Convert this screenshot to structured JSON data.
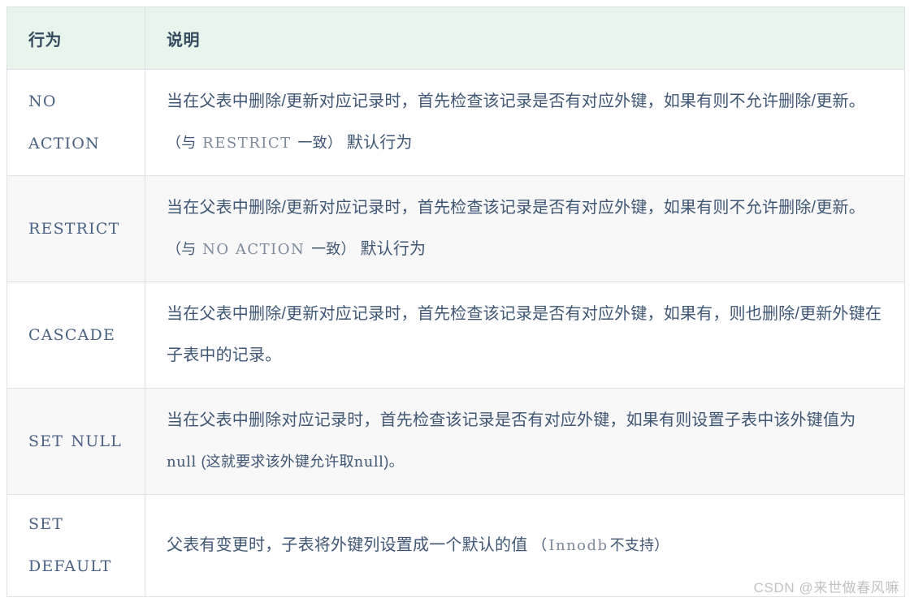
{
  "table": {
    "headers": {
      "action": "行为",
      "description": "说明"
    },
    "rows": [
      {
        "action": "NO ACTION",
        "desc_part1": "当在父表中删除/更新对应记录时，首先检查该记录是否有对应外键，如果有则不允许删除/更新。",
        "desc_paren_open": "（与",
        "desc_keyword": "RESTRICT",
        "desc_paren_close": "一致）",
        "desc_part2": "默认行为",
        "shaded": false
      },
      {
        "action": "RESTRICT",
        "desc_part1": "当在父表中删除/更新对应记录时，首先检查该记录是否有对应外键，如果有则不允许删除/更新。",
        "desc_paren_open": "（与",
        "desc_keyword": "NO ACTION",
        "desc_paren_close": "一致）",
        "desc_part2": "默认行为",
        "shaded": true
      },
      {
        "action": "CASCADE",
        "desc_part1": "当在父表中删除/更新对应记录时，首先检查该记录是否有对应外键，如果有，则也删除/更新外键在子表中的记录。",
        "desc_paren_open": "",
        "desc_keyword": "",
        "desc_paren_close": "",
        "desc_part2": "",
        "shaded": false
      },
      {
        "action": "SET NULL",
        "desc_part1": "当在父表中删除对应记录时，首先检查该记录是否有对应外键，如果有则设置子表中该外键值为",
        "desc_code1": "null",
        "desc_mid": "(这就要求该外键允许取",
        "desc_code2": "null",
        "desc_tail": ")。",
        "shaded": true
      },
      {
        "action": "SET DEFAULT",
        "desc_part1": "父表有变更时，子表将外键列设置成一个默认的值",
        "desc_paren_open": "（",
        "desc_keyword": "Innodb",
        "desc_paren_close": "不支持）",
        "desc_part2": "",
        "shaded": false
      }
    ]
  },
  "watermark": {
    "text": "CSDN @来世做春风嘛"
  },
  "colors": {
    "header_bg": "#e7f5ec",
    "border": "#dfe2e5",
    "text": "#3f5675",
    "alt_row_bg": "#f8f8f8",
    "keyword": "#7d8a9c",
    "watermark": "#c2c2c2"
  }
}
